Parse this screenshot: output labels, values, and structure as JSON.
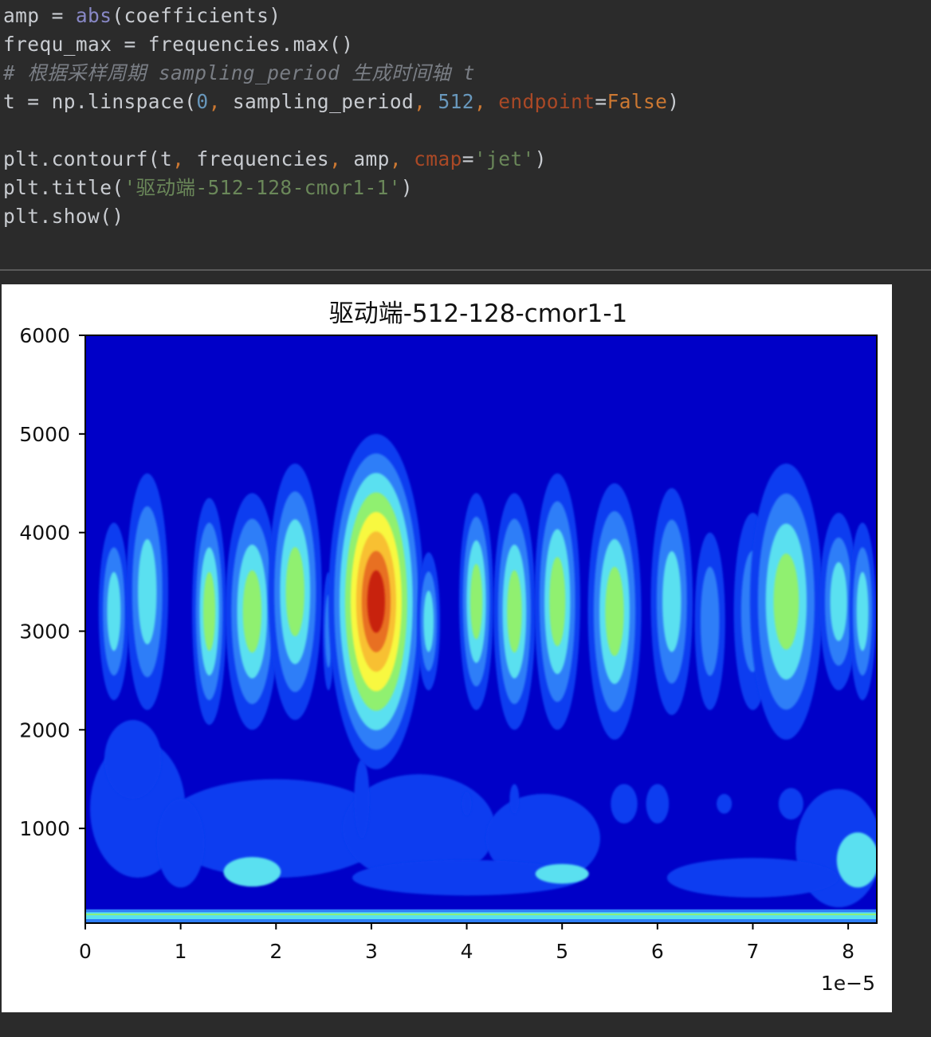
{
  "code": {
    "line1": {
      "var": "amp",
      "op": " = ",
      "func": "abs",
      "args": "(coefficients)"
    },
    "line2": {
      "text": "frequ_max = frequencies.max()"
    },
    "line3": {
      "comment": "# 根据采样周期 sampling_period 生成时间轴 t"
    },
    "line4": {
      "pre": "t = np.linspace(",
      "n0": "0",
      "c1": ",",
      "mid": " sampling_period",
      "c2": ",",
      "sp1": " ",
      "n512": "512",
      "c3": ",",
      "sp2": " ",
      "kwname": "endpoint",
      "eq": "=",
      "kwval": "False",
      "close": ")"
    },
    "line6": {
      "pre": "plt.contourf(t",
      "c1": ",",
      "a1": " frequencies",
      "c2": ",",
      "a2": " amp",
      "c3": ",",
      "sp": " ",
      "kwname": "cmap",
      "eq": "=",
      "str": "'jet'",
      "close": ")"
    },
    "line7": {
      "pre": "plt.title(",
      "str": "'驱动端-512-128-cmor1-1'",
      "close": ")"
    },
    "line8": {
      "text": "plt.show()"
    }
  },
  "colors": {
    "editor_background": "#2b2b2b",
    "code_text": "#c9ccd1",
    "builtin": "#8888c6",
    "number": "#6897bb",
    "keyword_value": "#cc7832",
    "param_name": "#aa4926",
    "string": "#6a8759",
    "comment": "#7a7e85"
  },
  "chart_data": {
    "type": "heatmap",
    "subtype": "filled contour (contourf)",
    "title": "驱动端-512-128-cmor1-1",
    "colormap": "jet",
    "xlim": [
      0,
      8.3
    ],
    "x_offset_label": "1e−5",
    "xticks": [
      "0",
      "1",
      "2",
      "3",
      "4",
      "5",
      "6",
      "7",
      "8"
    ],
    "ylim": [
      40,
      6000
    ],
    "yticks": [
      "1000",
      "2000",
      "3000",
      "4000",
      "5000",
      "6000"
    ],
    "grid": false,
    "levels_colors": [
      "#00007f",
      "#0000c8",
      "#0a3cf0",
      "#2f7ef8",
      "#5ae0f0",
      "#90f070",
      "#f8f840",
      "#f8c030",
      "#e87020",
      "#c82010"
    ],
    "features": [
      {
        "region": "main peak",
        "x": 3.0,
        "y": 3300,
        "level": "maximum (dark red)"
      },
      {
        "region": "band",
        "x_range": [
          0.2,
          8.2
        ],
        "y_range": [
          2300,
          5000
        ],
        "level": "medium (cyan/green)"
      },
      {
        "region": "low-frequency band",
        "x_range": [
          0,
          8.3
        ],
        "y_range": [
          40,
          1600
        ],
        "level": "low-medium (light blue)"
      }
    ]
  }
}
